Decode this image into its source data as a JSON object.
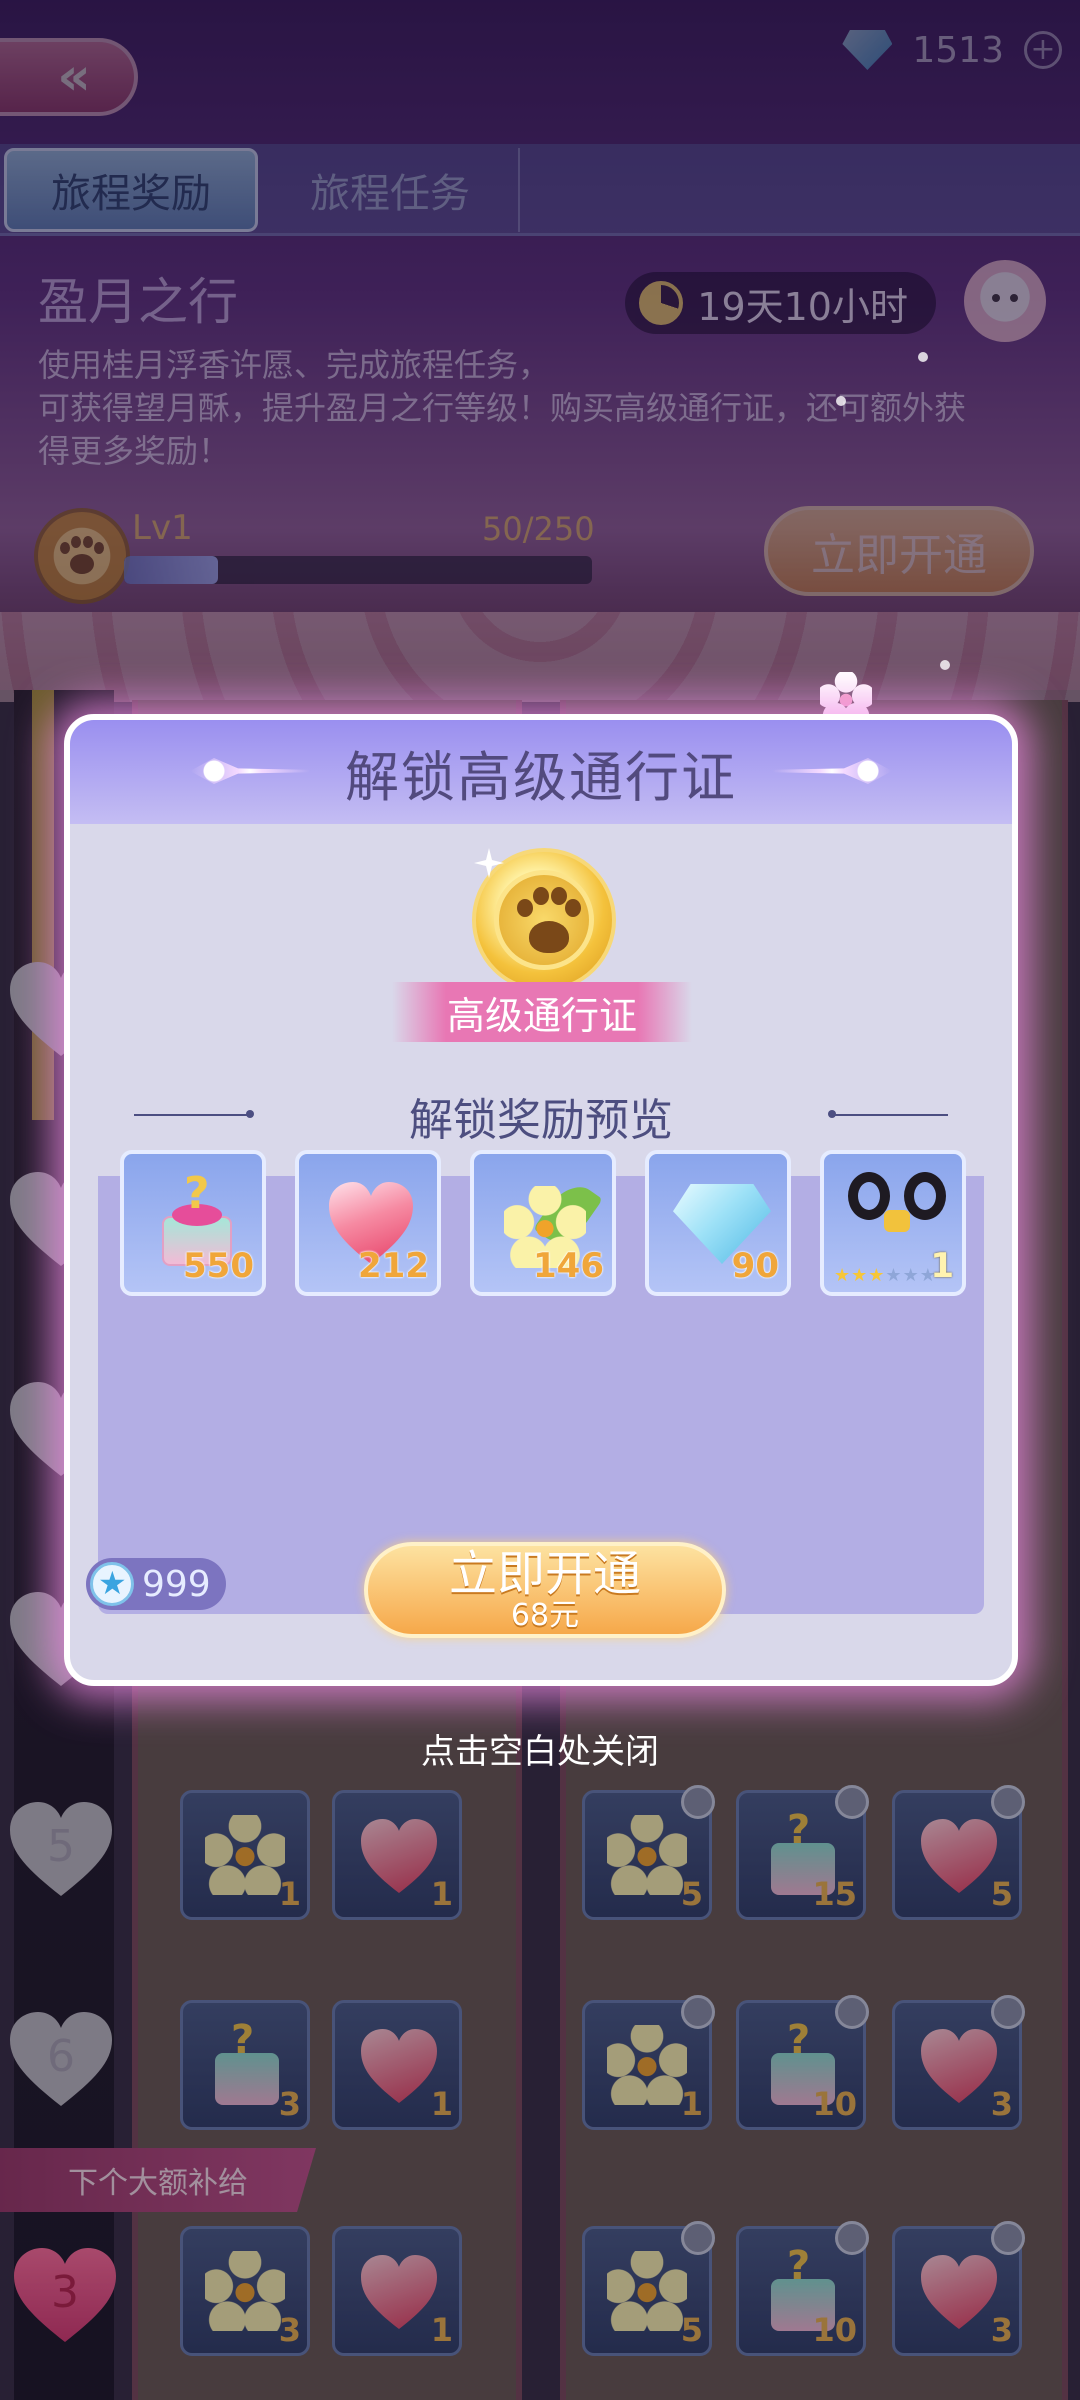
{
  "top_bar": {
    "back_icon": "double-chevron-left-icon",
    "currency": {
      "icon": "diamond-icon",
      "value": "1513",
      "add_icon": "plus-icon"
    }
  },
  "tabs": [
    {
      "label": "旅程奖励",
      "active": true
    },
    {
      "label": "旅程任务",
      "active": false
    }
  ],
  "event": {
    "title": "盈月之行",
    "timer": "19天10小时",
    "description_lines": [
      "使用桂月浮香许愿、完成旅程任务，",
      "可获得望月酥，提升盈月之行等级！购买高级通行证，还可额外获",
      "得更多奖励！"
    ],
    "level": {
      "label": "Lv1",
      "progress_text": "50/250",
      "progress": 0.2
    },
    "activate_label": "立即开通"
  },
  "track": {
    "rows": [
      {
        "level": "5",
        "free": [
          {
            "item": "flower",
            "qty": "1"
          },
          {
            "item": "heart",
            "qty": "1"
          }
        ],
        "paid": [
          {
            "item": "flower",
            "qty": "5"
          },
          {
            "item": "gift",
            "qty": "15"
          },
          {
            "item": "heart",
            "qty": "5"
          }
        ]
      },
      {
        "level": "6",
        "free": [
          {
            "item": "gift",
            "qty": "3"
          },
          {
            "item": "heart",
            "qty": "1"
          }
        ],
        "paid": [
          {
            "item": "flower",
            "qty": "1"
          },
          {
            "item": "gift",
            "qty": "10"
          },
          {
            "item": "heart",
            "qty": "3"
          }
        ]
      }
    ],
    "next_bonus": {
      "label": "下个大额补给",
      "level": "3",
      "free": [
        {
          "item": "flower",
          "qty": "3"
        },
        {
          "item": "heart",
          "qty": "1"
        }
      ],
      "paid": [
        {
          "item": "flower",
          "qty": "5"
        },
        {
          "item": "gift",
          "qty": "10"
        },
        {
          "item": "heart",
          "qty": "3"
        }
      ]
    }
  },
  "modal": {
    "title": "解锁高级通行证",
    "pass_label": "高级通行证",
    "preview_title": "解锁奖励预览",
    "rewards": [
      {
        "icon": "mystery-gift-icon",
        "qty": "550"
      },
      {
        "icon": "heart-bottle-icon",
        "qty": "212"
      },
      {
        "icon": "flower-icon",
        "qty": "146"
      },
      {
        "icon": "diamond-icon",
        "qty": "90"
      },
      {
        "icon": "black-bow-icon",
        "qty": "1",
        "stars_filled": 3,
        "stars_total": 6
      }
    ],
    "star_balance": "999",
    "activate_label": "立即开通",
    "activate_price": "68元",
    "close_hint": "点击空白处关闭"
  }
}
